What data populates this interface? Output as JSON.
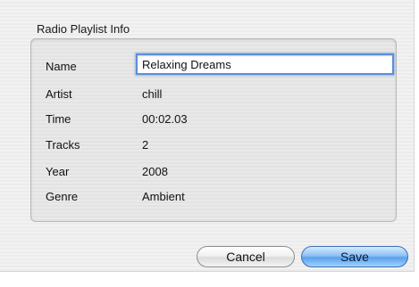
{
  "dialog": {
    "group_title": "Radio Playlist Info",
    "fields": {
      "name": {
        "label": "Name",
        "value": "Relaxing Dreams"
      },
      "artist": {
        "label": "Artist",
        "value": "chill"
      },
      "time": {
        "label": "Time",
        "value": "00:02.03"
      },
      "tracks": {
        "label": "Tracks",
        "value": "2"
      },
      "year": {
        "label": "Year",
        "value": "2008"
      },
      "genre": {
        "label": "Genre",
        "value": "Ambient"
      }
    },
    "buttons": {
      "cancel_label": "Cancel",
      "save_label": "Save"
    }
  },
  "colors": {
    "focus_ring": "#5d8fd7",
    "default_button": "#5aa0ea"
  }
}
